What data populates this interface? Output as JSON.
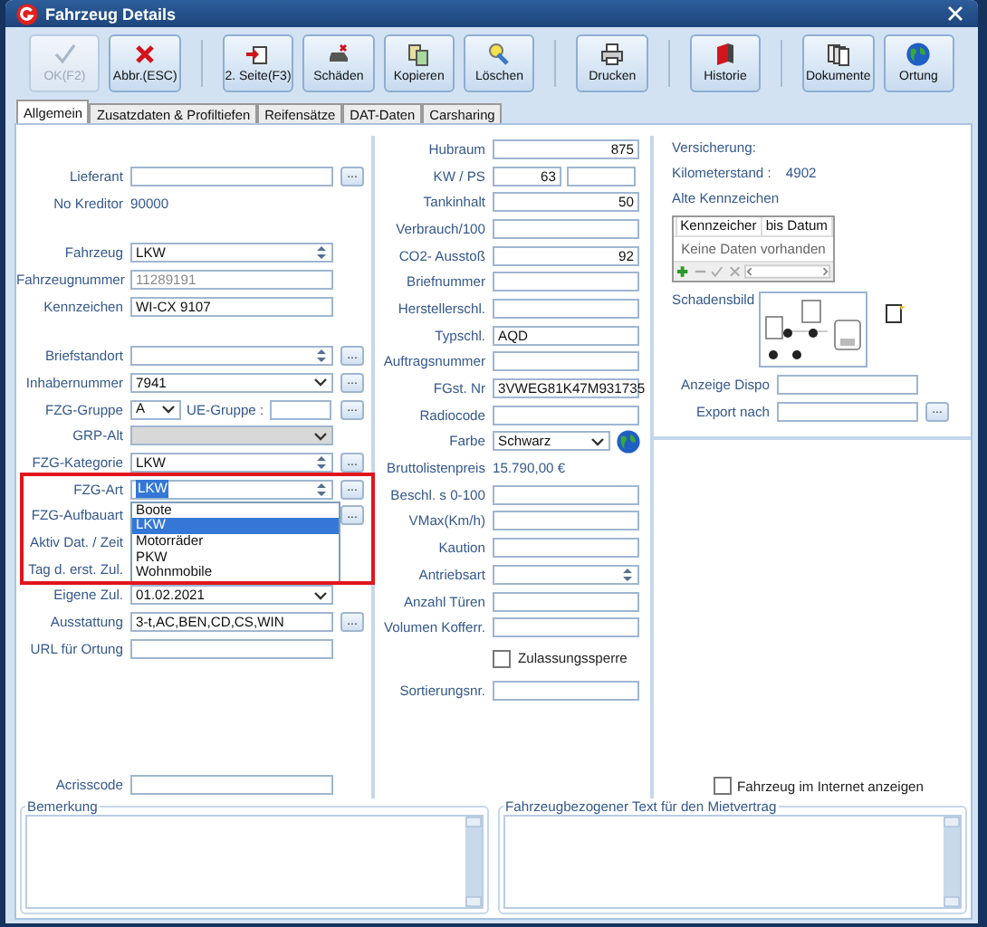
{
  "window": {
    "title": "Fahrzeug Details"
  },
  "toolbar": [
    [
      {
        "label": "OK(F2)",
        "kind": "check",
        "disabled": true
      },
      {
        "label": "Abbr.(ESC)",
        "kind": "cross",
        "disabled": false
      }
    ],
    [
      {
        "label": "2. Seite(F3)",
        "kind": "page",
        "disabled": false
      },
      {
        "label": "Schäden",
        "kind": "damage",
        "disabled": false
      },
      {
        "label": "Kopieren",
        "kind": "copy",
        "disabled": false
      },
      {
        "label": "Löschen",
        "kind": "erase",
        "disabled": false
      }
    ],
    [
      {
        "label": "Drucken",
        "kind": "print",
        "disabled": false
      }
    ],
    [
      {
        "label": "Historie",
        "kind": "history",
        "disabled": false
      }
    ],
    [
      {
        "label": "Dokumente",
        "kind": "docs",
        "disabled": false
      },
      {
        "label": "Ortung",
        "kind": "globe",
        "disabled": false
      }
    ]
  ],
  "tabs": [
    {
      "label": "Allgemein",
      "selected": true
    },
    {
      "label": "Zusatzdaten & Profiltiefen",
      "selected": false
    },
    {
      "label": "Reifensätze",
      "selected": false
    },
    {
      "label": "DAT-Daten",
      "selected": false
    },
    {
      "label": "Carsharing",
      "selected": false
    }
  ],
  "left": {
    "groups": [
      [
        {
          "label": "Lieferant",
          "kind": "text",
          "button": "..."
        },
        {
          "label": "No Kreditor",
          "kind": "info",
          "value": "90000"
        }
      ],
      [
        {
          "label": "Fahrzeug",
          "kind": "spin",
          "value": "LKW"
        },
        {
          "label": "Fahrzeugnummer",
          "kind": "readonly",
          "value": "11289191"
        },
        {
          "label": "Kennzeichen",
          "kind": "text",
          "value": "WI-CX 9107"
        }
      ],
      [
        {
          "label": "Briefstandort",
          "kind": "spin",
          "button": "..."
        },
        {
          "label": "Inhabernummer",
          "kind": "select",
          "value": "7941",
          "button": "..."
        },
        {
          "label": "FZG-Gruppe",
          "kind": "split",
          "value": "A",
          "sub": "UE-Gruppe :",
          "button": "..."
        },
        {
          "label": "GRP-Alt",
          "kind": "locked"
        },
        {
          "label": "FZG-Kategorie",
          "kind": "spin",
          "value": "LKW",
          "button": "..."
        },
        {
          "label": "FZG-Art",
          "kind": "open",
          "value": "LKW",
          "button": "...",
          "options": [
            {
              "label": "Boote",
              "selected": false
            },
            {
              "label": "LKW",
              "selected": true
            },
            {
              "label": "Motorräder",
              "selected": false
            },
            {
              "label": "PKW",
              "selected": false
            },
            {
              "label": "Wohnmobile",
              "selected": false
            }
          ]
        },
        {
          "label": "FZG-Aufbauart",
          "kind": "covered",
          "button": "..."
        },
        {
          "label": "Aktiv Dat. / Zeit",
          "kind": "covered"
        },
        {
          "label": "Tag d. erst. Zul.",
          "kind": "covered"
        },
        {
          "label": "Eigene Zul.",
          "kind": "select",
          "value": "01.02.2021"
        },
        {
          "label": "Ausstattung",
          "kind": "text",
          "value": "3-t,AC,BEN,CD,CS,WIN",
          "button": "..."
        },
        {
          "label": "URL für Ortung",
          "kind": "text"
        }
      ]
    ],
    "footer": [
      {
        "label": "Acrisscode",
        "kind": "text"
      }
    ]
  },
  "annotation": {
    "kind": "frame"
  },
  "middle": [
    {
      "label": "Hubraum",
      "kind": "number",
      "value": "875"
    },
    {
      "label": "KW / PS",
      "kind": "pair",
      "value": "63"
    },
    {
      "label": "Tankinhalt",
      "kind": "number",
      "value": "50"
    },
    {
      "label": "Verbrauch/100",
      "kind": "text"
    },
    {
      "label": "CO2- Ausstoß",
      "kind": "number",
      "value": "92"
    },
    {
      "label": "Briefnummer",
      "kind": "text"
    },
    {
      "label": "Herstellerschl.",
      "kind": "text"
    },
    {
      "label": "Typschl.",
      "kind": "text",
      "value": "AQD"
    },
    {
      "label": "Auftragsnummer",
      "kind": "text"
    },
    {
      "label": "FGst. Nr",
      "kind": "text",
      "value": "3VWEG81K47M931735"
    },
    {
      "label": "Radiocode",
      "kind": "text"
    },
    {
      "label": "Farbe",
      "kind": "color",
      "value": "Schwarz"
    },
    {
      "label": "Bruttolistenpreis",
      "kind": "info",
      "value": "15.790,00 €"
    },
    {
      "label": "Beschl. s 0-100",
      "kind": "text"
    },
    {
      "label": "VMax(Km/h)",
      "kind": "text"
    },
    {
      "label": "Kaution",
      "kind": "text"
    },
    {
      "label": "Antriebsart",
      "kind": "spin"
    },
    {
      "label": "Anzahl Türen",
      "kind": "text"
    },
    {
      "label": "Volumen Kofferr.",
      "kind": "text"
    },
    {
      "label": "Zulassungssperre",
      "kind": "check",
      "checked": false
    },
    {
      "label": "Sortierungsnr.",
      "kind": "text"
    }
  ],
  "right": {
    "insurance": "Versicherung:",
    "mileage_label": "Kilometerstand :",
    "mileage": "4902",
    "plates_label": "Alte Kennzeichen",
    "plates_columns": [
      "Kennzeicher",
      "bis Datum"
    ],
    "plates_empty": "Keine Daten vorhanden",
    "damage_label": "Schadensbild",
    "rows": [
      {
        "label": "Anzeige Dispo",
        "kind": "text"
      },
      {
        "label": "Export nach",
        "kind": "text",
        "button": "..."
      }
    ],
    "internet": {
      "label": "Fahrzeug im Internet anzeigen",
      "checked": false
    }
  },
  "memos": [
    {
      "title": "Bemerkung"
    },
    {
      "title": "Fahrzeugbezogener Text für den Mietvertrag"
    }
  ]
}
